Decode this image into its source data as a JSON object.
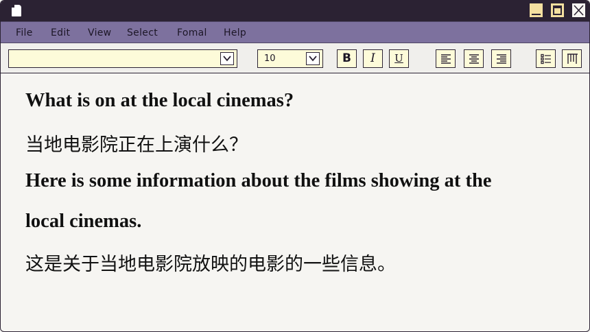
{
  "menu": [
    "File",
    "Edit",
    "View",
    "Select",
    "Fomal",
    "Help"
  ],
  "toolbar": {
    "font_value": "",
    "size_value": "10",
    "bold_label": "B",
    "italic_label": "I",
    "underline_label": "U"
  },
  "document": {
    "lines": [
      "What is on at the local cinemas?",
      "当地电影院正在上演什么？",
      "Here is some information about the films showing at the",
      "local cinemas.",
      "这是关于当地电影院放映的电影的一些信息。"
    ]
  }
}
